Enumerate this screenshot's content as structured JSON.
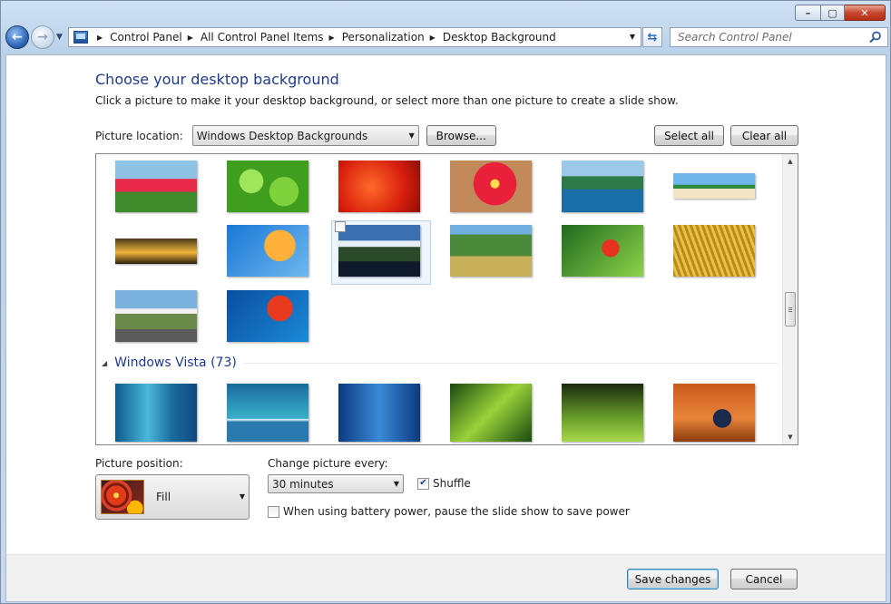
{
  "window": {
    "caption_buttons": [
      "minimize-icon",
      "maximize-icon",
      "close-icon"
    ]
  },
  "address_bar": {
    "breadcrumbs": [
      "Control Panel",
      "All Control Panel Items",
      "Personalization",
      "Desktop Background"
    ]
  },
  "search": {
    "placeholder": "Search Control Panel"
  },
  "page": {
    "heading": "Choose your desktop background",
    "subtitle": "Click a picture to make it your desktop background, or select more than one picture to create a slide show.",
    "picture_location_label": "Picture location:",
    "picture_location_value": "Windows Desktop Backgrounds",
    "browse_label": "Browse...",
    "select_all_label": "Select all",
    "clear_all_label": "Clear all"
  },
  "gallery": {
    "group_title": "Windows Vista (73)",
    "colors": {
      "accent": "#1e3a8a",
      "selection": "#eef5fd"
    }
  },
  "options": {
    "picture_position_label": "Picture position:",
    "picture_position_value": "Fill",
    "change_every_label": "Change picture every:",
    "change_every_value": "30 minutes",
    "shuffle_label": "Shuffle",
    "shuffle_checked": true,
    "battery_label": "When using battery power, pause the slide show to save power",
    "battery_checked": false
  },
  "footer": {
    "save_label": "Save changes",
    "cancel_label": "Cancel"
  }
}
